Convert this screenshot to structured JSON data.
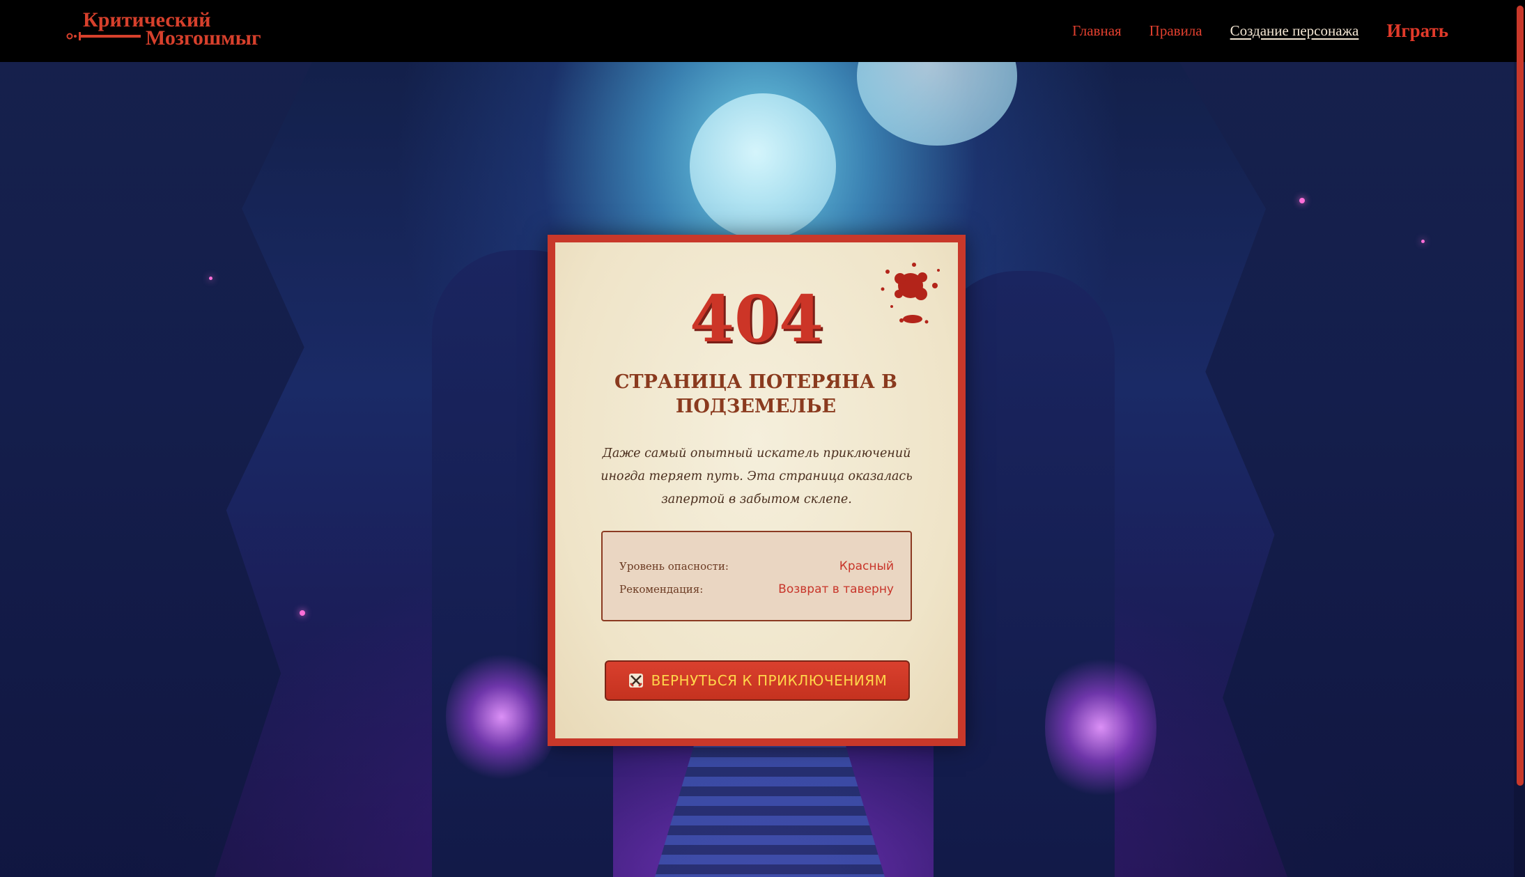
{
  "brand": {
    "line1": "Критический",
    "line2": "Мозгошмыг"
  },
  "nav": {
    "items": [
      {
        "label": "Главная"
      },
      {
        "label": "Правила"
      },
      {
        "label": "Создание персонажа"
      },
      {
        "label": "Играть"
      }
    ],
    "active_index": 2
  },
  "error": {
    "code": "404",
    "title": "СТРАНИЦА ПОТЕРЯНА В ПОДЗЕМЕЛЬЕ",
    "description": "Даже самый опытный искатель приключений иногда теряет путь. Эта страница оказалась запертой в забытом склепе.",
    "info": [
      {
        "label": "Уровень опасности:",
        "value": "Красный"
      },
      {
        "label": "Рекомендация:",
        "value": "Возврат в таверну"
      }
    ],
    "button_label": "ВЕРНУТЬСЯ К ПРИКЛЮЧЕНИЯМ",
    "button_icon": "crossed-swords-icon"
  },
  "colors": {
    "accent": "#d7402c",
    "button_text": "#ffd64a",
    "card_bg": "#f2e8d0",
    "header_bg": "#000000"
  }
}
